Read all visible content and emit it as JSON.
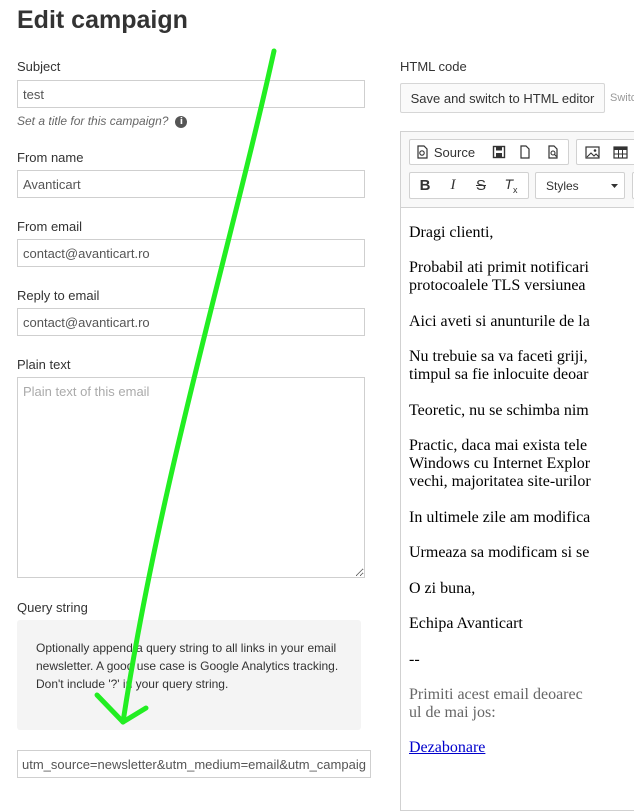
{
  "page": {
    "title": "Edit campaign"
  },
  "form": {
    "subject": {
      "label": "Subject",
      "value": "test",
      "hint": "Set a title for this campaign?"
    },
    "from_name": {
      "label": "From name",
      "value": "Avanticart"
    },
    "from_email": {
      "label": "From email",
      "value": "contact@avanticart.ro"
    },
    "reply_to": {
      "label": "Reply to email",
      "value": "contact@avanticart.ro"
    },
    "plain_text": {
      "label": "Plain text",
      "placeholder": "Plain text of this email"
    },
    "query_string": {
      "label": "Query string",
      "help": "Optionally append a query string to all links in your email newsletter. A good use case is Google Analytics tracking. Don't include '?' in your query string.",
      "value": "utm_source=newsletter&utm_medium=email&utm_campaig"
    }
  },
  "html_panel": {
    "label": "HTML code",
    "switch_button": "Save and switch to HTML editor",
    "switch_note": "Switc",
    "toolbar": {
      "source": "Source",
      "styles": "Styles",
      "icons": [
        "source-icon",
        "save-icon",
        "new-page-icon",
        "preview-icon",
        "image-icon",
        "table-icon",
        "bold-icon",
        "italic-icon",
        "strikethrough-icon",
        "remove-format-icon"
      ]
    },
    "content": {
      "p1": "Dragi clienti,",
      "p2a": "Probabil ati primit notificari",
      "p2b": "protocoalele TLS versiunea",
      "p3": "Aici aveti si anunturile de la",
      "p4a": "Nu trebuie sa va faceti griji,",
      "p4b": "timpul sa fie inlocuite deoar",
      "p5": "Teoretic, nu se schimba nim",
      "p6a": "Practic, daca mai exista tele",
      "p6b": "Windows cu Internet Explor",
      "p6c": "vechi, majoritatea site-urilor",
      "p7": "In ultimele zile am modifica",
      "p8": "Urmeaza sa modificam si se",
      "p9": "O zi buna,",
      "p10": "Echipa Avanticart",
      "p11": "--",
      "p12a": "Primiti acest email deoarec",
      "p12b": "ul de mai jos:",
      "unsubscribe": "Dezabonare"
    }
  },
  "colors": {
    "annotation_arrow": "#22ee22",
    "link": "#0000cc"
  }
}
